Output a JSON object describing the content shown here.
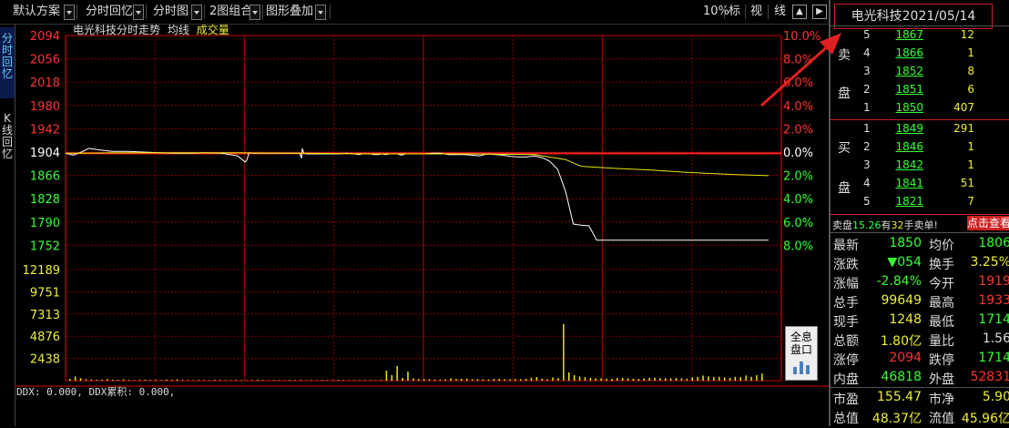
{
  "toolbar": {
    "items": [
      "默认方案",
      "分时回忆",
      "分时图",
      "2图组合",
      "图形叠加"
    ],
    "right": [
      "10%",
      "标",
      "视",
      "线"
    ]
  },
  "left_tabs": {
    "intraday": "分时回忆",
    "kline": "K线回忆"
  },
  "chart_header": {
    "title": "电光科技分时走势",
    "avg": "均线",
    "vol": "成交量"
  },
  "ddx_line": "DDX: 0.000, DDX累积: 0.000,",
  "quick_button": {
    "line1": "全息",
    "line2": "盘口"
  },
  "colors": {
    "up": "#ff3333",
    "down": "#33ff33",
    "price_line": "#ffffff",
    "avg_line": "#e8e800",
    "grid": "#8b0000",
    "volume": "#e8e800"
  },
  "chart_data": {
    "type": "line",
    "title": "电光科技分时走势",
    "price_axis": {
      "prev_close": 1904,
      "labels": [
        "2094",
        "2056",
        "2018",
        "1980",
        "1942",
        "1904",
        "1866",
        "1828",
        "1790",
        "1752"
      ],
      "pct_labels": [
        "10.0%",
        "8.0%",
        "6.0%",
        "4.0%",
        "2.0%",
        "0.0%",
        "2.0%",
        "4.0%",
        "6.0%",
        "8.0%"
      ],
      "ylim": [
        1733,
        2094
      ]
    },
    "volume_axis": {
      "labels": [
        "12189",
        "9751",
        "7313",
        "4876",
        "2438"
      ],
      "ylim": [
        0,
        12189
      ]
    },
    "series": [
      {
        "name": "价格",
        "x": [
          0,
          10,
          20,
          30,
          40,
          60,
          80,
          100,
          120,
          140,
          160,
          180,
          200,
          220,
          230,
          232,
          235,
          240,
          260,
          280,
          300,
          302,
          303,
          305,
          310,
          320,
          330,
          340,
          350,
          360,
          370,
          375,
          380,
          385,
          390,
          395,
          400,
          405,
          410,
          415,
          420,
          425,
          430,
          435,
          440,
          450,
          460,
          470,
          480,
          490,
          500,
          510,
          520,
          530,
          540,
          550,
          560,
          570,
          580,
          590,
          600,
          610,
          620,
          630,
          640,
          650,
          660,
          670,
          680,
          690,
          700,
          710,
          720,
          730,
          740,
          750,
          760,
          770,
          780,
          790,
          800,
          810,
          820,
          830,
          840,
          850,
          860,
          870,
          880,
          890,
          900
        ],
        "y": [
          1904,
          1901,
          1906,
          1912,
          1910,
          1907,
          1907,
          1906,
          1905,
          1904,
          1904,
          1905,
          1904,
          1900,
          1890,
          1893,
          1905,
          1904,
          1904,
          1904,
          1904,
          1896,
          1912,
          1904,
          1903,
          1903,
          1903,
          1903,
          1903,
          1904,
          1903,
          1902,
          1903,
          1903,
          1903,
          1902,
          1902,
          1903,
          1902,
          1903,
          1903,
          1903,
          1901,
          1903,
          1903,
          1903,
          1903,
          1904,
          1904,
          1902,
          1902,
          1902,
          1901,
          1900,
          1903,
          1902,
          1901,
          1899,
          1898,
          1898,
          1900,
          1897,
          1891,
          1878,
          1843,
          1790,
          1788,
          1787,
          1764,
          1764,
          1764,
          1764,
          1764,
          1764,
          1764,
          1764,
          1764,
          1764,
          1764,
          1764,
          1764,
          1764,
          1764,
          1764,
          1764,
          1764,
          1764,
          1764,
          1764,
          1764,
          1764
        ]
      },
      {
        "name": "均价",
        "x": [
          0,
          100,
          200,
          300,
          400,
          500,
          600,
          640,
          660,
          700,
          750,
          800,
          850,
          900
        ],
        "y": [
          1904,
          1905,
          1905,
          1904,
          1903,
          1903,
          1902,
          1894,
          1883,
          1880,
          1877,
          1873,
          1870,
          1868
        ]
      }
    ],
    "volume": [
      200,
      450,
      280,
      150,
      120,
      90,
      110,
      180,
      100,
      90,
      140,
      80,
      60,
      90,
      100,
      70,
      80,
      60,
      120,
      90,
      150,
      80,
      60,
      50,
      70,
      60,
      50,
      90,
      70,
      60,
      50,
      70,
      60,
      50,
      60,
      90,
      60,
      50,
      70,
      60,
      50,
      80,
      60,
      70,
      50,
      60,
      50,
      70,
      60,
      60,
      80,
      60,
      50,
      60,
      50,
      70,
      60,
      50,
      80,
      1100,
      600,
      1600,
      300,
      1000,
      250,
      180,
      160,
      150,
      130,
      120,
      140,
      260,
      180,
      200,
      220,
      150,
      160,
      140,
      120,
      180,
      200,
      160,
      150,
      170,
      160,
      200,
      320,
      400,
      220,
      150,
      350,
      280,
      6200,
      900,
      600,
      450,
      380,
      300,
      260,
      240,
      220,
      200,
      280,
      300,
      260,
      220,
      200,
      240,
      300,
      320,
      280,
      260,
      240,
      300,
      250,
      220,
      380,
      420,
      560,
      460,
      380,
      420,
      360,
      300,
      420,
      380,
      560,
      420,
      600,
      780
    ]
  },
  "panel": {
    "title": "电光科技2021/05/14",
    "sell_label_1": "卖",
    "sell_label_2": "盘",
    "buy_label_1": "买",
    "buy_label_2": "盘",
    "sell": [
      {
        "level": "5",
        "price": "1867",
        "vol": "12"
      },
      {
        "level": "4",
        "price": "1866",
        "vol": "1"
      },
      {
        "level": "3",
        "price": "1852",
        "vol": "8"
      },
      {
        "level": "2",
        "price": "1851",
        "vol": "6"
      },
      {
        "level": "1",
        "price": "1850",
        "vol": "407"
      }
    ],
    "buy": [
      {
        "level": "1",
        "price": "1849",
        "vol": "291"
      },
      {
        "level": "2",
        "price": "1846",
        "vol": "1"
      },
      {
        "level": "3",
        "price": "1842",
        "vol": "1"
      },
      {
        "level": "4",
        "price": "1841",
        "vol": "51"
      },
      {
        "level": "5",
        "price": "1821",
        "vol": "7"
      }
    ],
    "ticker_prefix": "卖盘",
    "ticker_val1": "15.26",
    "ticker_mid": "有",
    "ticker_val2": "32",
    "ticker_suffix": "手卖单!",
    "click_view": "点击查看",
    "stats": [
      {
        "k": "最新",
        "v": "1850",
        "k2": "均价",
        "v2": "1806"
      },
      {
        "k": "涨跌",
        "v": "▼054",
        "k2": "换手",
        "v2": "3.25%"
      },
      {
        "k": "涨幅",
        "v": "-2.84%",
        "k2": "今开",
        "v2": "1919"
      },
      {
        "k": "总手",
        "v": "99649",
        "k2": "最高",
        "v2": "1933"
      },
      {
        "k": "现手",
        "v": "1248",
        "k2": "最低",
        "v2": "1714"
      },
      {
        "k": "总额",
        "v": "1.80亿",
        "k2": "量比",
        "v2": "1.56"
      },
      {
        "k": "涨停",
        "v": "2094",
        "k2": "跌停",
        "v2": "1714"
      },
      {
        "k": "内盘",
        "v": "46818",
        "k2": "外盘",
        "v2": "52831"
      }
    ],
    "stats2": [
      {
        "k": "市盈",
        "v": "155.47",
        "k2": "市净",
        "v2": "5.90"
      },
      {
        "k": "总值",
        "v": "48.37亿",
        "k2": "流值",
        "v2": "45.96亿"
      }
    ]
  }
}
